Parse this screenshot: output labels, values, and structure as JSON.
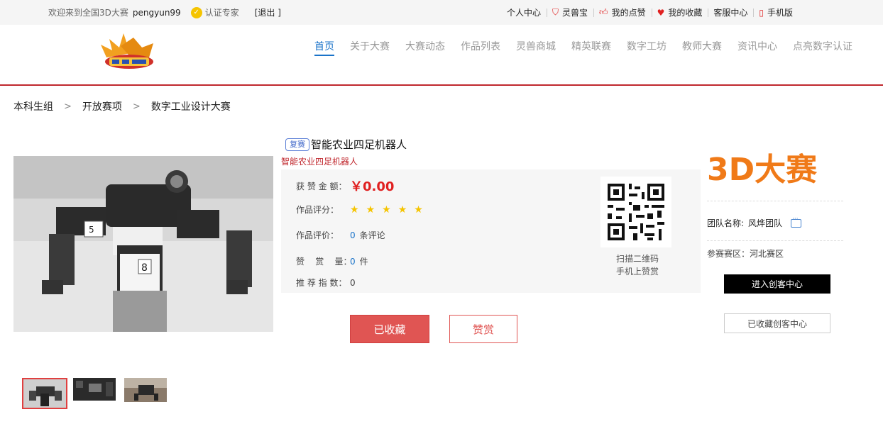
{
  "topbar": {
    "welcome": "欢迎来到全国3D大赛",
    "username": "pengyun99",
    "certified": "认证专家",
    "logout": "[退出 ]",
    "links": [
      {
        "label": "个人中心",
        "icon": ""
      },
      {
        "label": "灵兽宝",
        "icon": "shield-icon"
      },
      {
        "label": "我的点赞",
        "icon": "thumbs-up-icon"
      },
      {
        "label": "我的收藏",
        "icon": "heart-icon"
      },
      {
        "label": "客服中心",
        "icon": ""
      },
      {
        "label": "手机版",
        "icon": "mobile-icon"
      }
    ]
  },
  "nav": {
    "items": [
      "首页",
      "关于大赛",
      "大赛动态",
      "作品列表",
      "灵兽商城",
      "精英联赛",
      "数字工坊",
      "教师大赛",
      "资讯中心",
      "点亮数字认证"
    ],
    "active_index": 0
  },
  "breadcrumb": [
    "本科生组",
    "开放赛项",
    "数字工业设计大赛"
  ],
  "work": {
    "tag": "复赛",
    "title": "智能农业四足机器人",
    "subtitle": "智能农业四足机器人",
    "reward_label": "获 赞 金 额：",
    "reward_amount": "￥0.00",
    "score_label": "作品评分：",
    "rating": 5,
    "max_rating": 5,
    "review_label": "作品评价：",
    "review_count": "0",
    "review_unit": "条评论",
    "likes_label": "赞    赏    量：",
    "likes_count": "0",
    "likes_unit": "件",
    "recommend_label": "推 荐 指 数：",
    "recommend_value": "0",
    "qr_text_1": "扫描二维码",
    "qr_text_2": "手机上赞赏"
  },
  "buttons": {
    "favorited": "已收藏",
    "reward": "赞赏"
  },
  "sidebar": {
    "brand_text": "3D大赛",
    "team_label": "团队名称:",
    "team_name": "风烨团队",
    "region_label": "参赛赛区：",
    "region": "河北赛区",
    "maker_button": "进入创客中心",
    "maker_fav_button": "已收藏创客中心"
  },
  "colors": {
    "accent_red": "#c0272d",
    "nav_active": "#1a73c9",
    "price": "#e02020"
  }
}
